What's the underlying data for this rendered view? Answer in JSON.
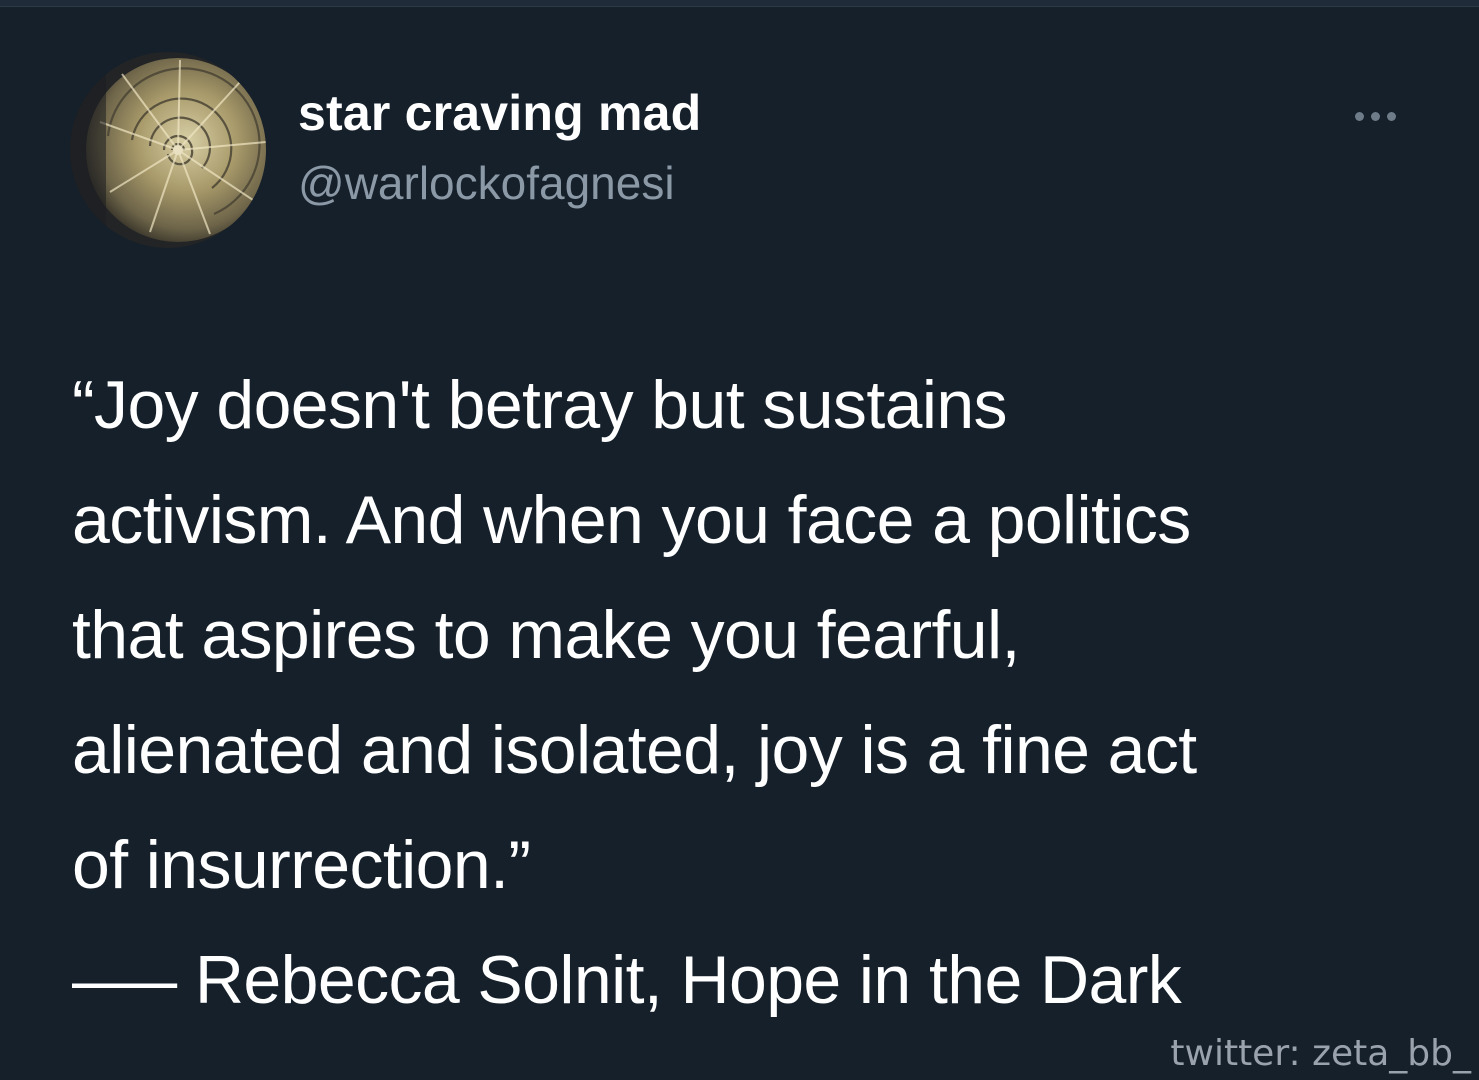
{
  "author": {
    "display_name": "star craving mad",
    "handle": "@warlockofagnesi",
    "avatar_icon": "nautilus-shell-avatar"
  },
  "menu": {
    "icon": "more-options-icon"
  },
  "tweet": {
    "lines": [
      "“Joy doesn't betray but sustains",
      "activism. And when you face a politics",
      "that aspires to make you fearful,",
      "alienated and isolated, joy is a fine act",
      "of insurrection.”",
      "—– Rebecca Solnit, Hope in the Dark"
    ]
  },
  "watermark": "twitter: zeta_bb_",
  "colors": {
    "background": "#15202b",
    "text": "#ffffff",
    "secondary_text": "#8b98a5"
  }
}
